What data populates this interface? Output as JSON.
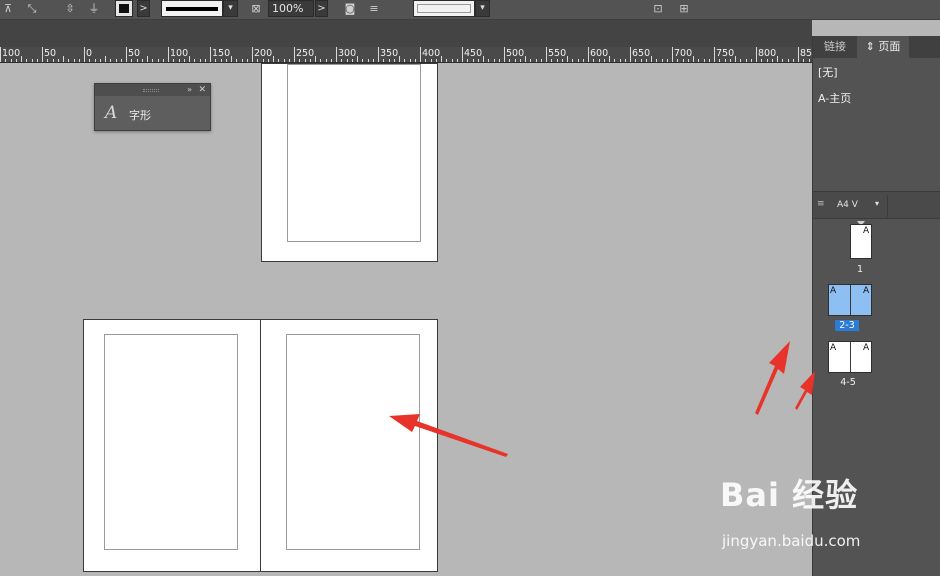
{
  "toolbar": {
    "zoom_value": "100%",
    "next_arrow": ">",
    "dropdown_arrow": "▾"
  },
  "ruler": {
    "labels": [
      "100",
      "50",
      "0",
      "50",
      "100",
      "150",
      "200",
      "250",
      "300",
      "350",
      "400",
      "450",
      "500",
      "550",
      "600",
      "650",
      "700",
      "750",
      "800",
      "85"
    ]
  },
  "glyph_panel": {
    "collapse_symbol": "»",
    "close_symbol": "✕",
    "icon_char": "A",
    "label": "字形"
  },
  "side_panel": {
    "tabs": [
      {
        "label": "链接",
        "active": false
      },
      {
        "label": "⇕ 页面",
        "active": true
      }
    ],
    "masters": [
      "[无]",
      "A-主页"
    ],
    "page_size_label": "A4 V",
    "menu_symbol": "≡",
    "page_groups": [
      {
        "label": "1",
        "selected": false,
        "master_letters": [
          "A"
        ]
      },
      {
        "label": "2-3",
        "selected": true,
        "master_letters": [
          "A",
          "A"
        ]
      },
      {
        "label": "4-5",
        "selected": false,
        "master_letters": [
          "A",
          "A"
        ]
      }
    ]
  },
  "watermark": {
    "brand": "Bai 经验",
    "url": "jingyan.baidu.com"
  },
  "colors": {
    "canvas": "#b7b7b7",
    "panel": "#535353",
    "selected_page": "#8dbff3",
    "selected_label": "#2c7bd6",
    "arrow": "#e8332a"
  }
}
